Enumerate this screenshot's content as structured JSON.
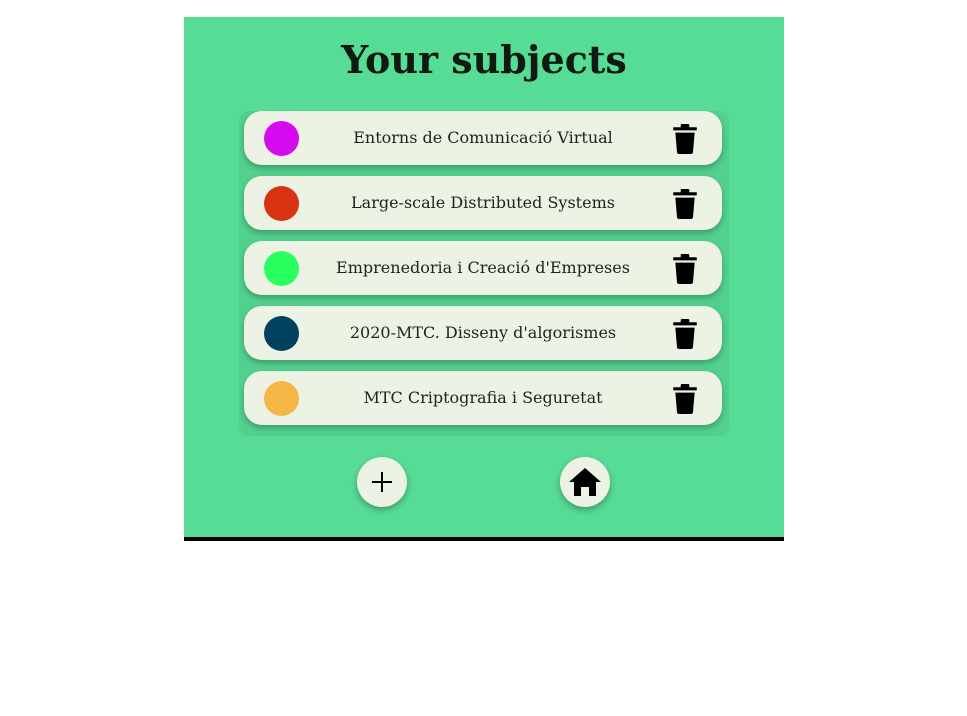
{
  "page": {
    "title": "Your subjects"
  },
  "subjects": [
    {
      "name": "Entorns de Comunicació Virtual",
      "color": "#d40bef"
    },
    {
      "name": "Large-scale Distributed Systems",
      "color": "#d83212"
    },
    {
      "name": "Emprenedoria i Creació d'Empreses",
      "color": "#29ff5e"
    },
    {
      "name": "2020-MTC. Disseny d'algorismes",
      "color": "#00425e"
    },
    {
      "name": "MTC Criptografia i Seguretat",
      "color": "#f6b645"
    }
  ],
  "icons": {
    "delete": "trash-icon",
    "add": "plus-icon",
    "home": "home-icon"
  },
  "colors": {
    "panel_background": "#57dc96",
    "item_background": "#edf3e4"
  }
}
